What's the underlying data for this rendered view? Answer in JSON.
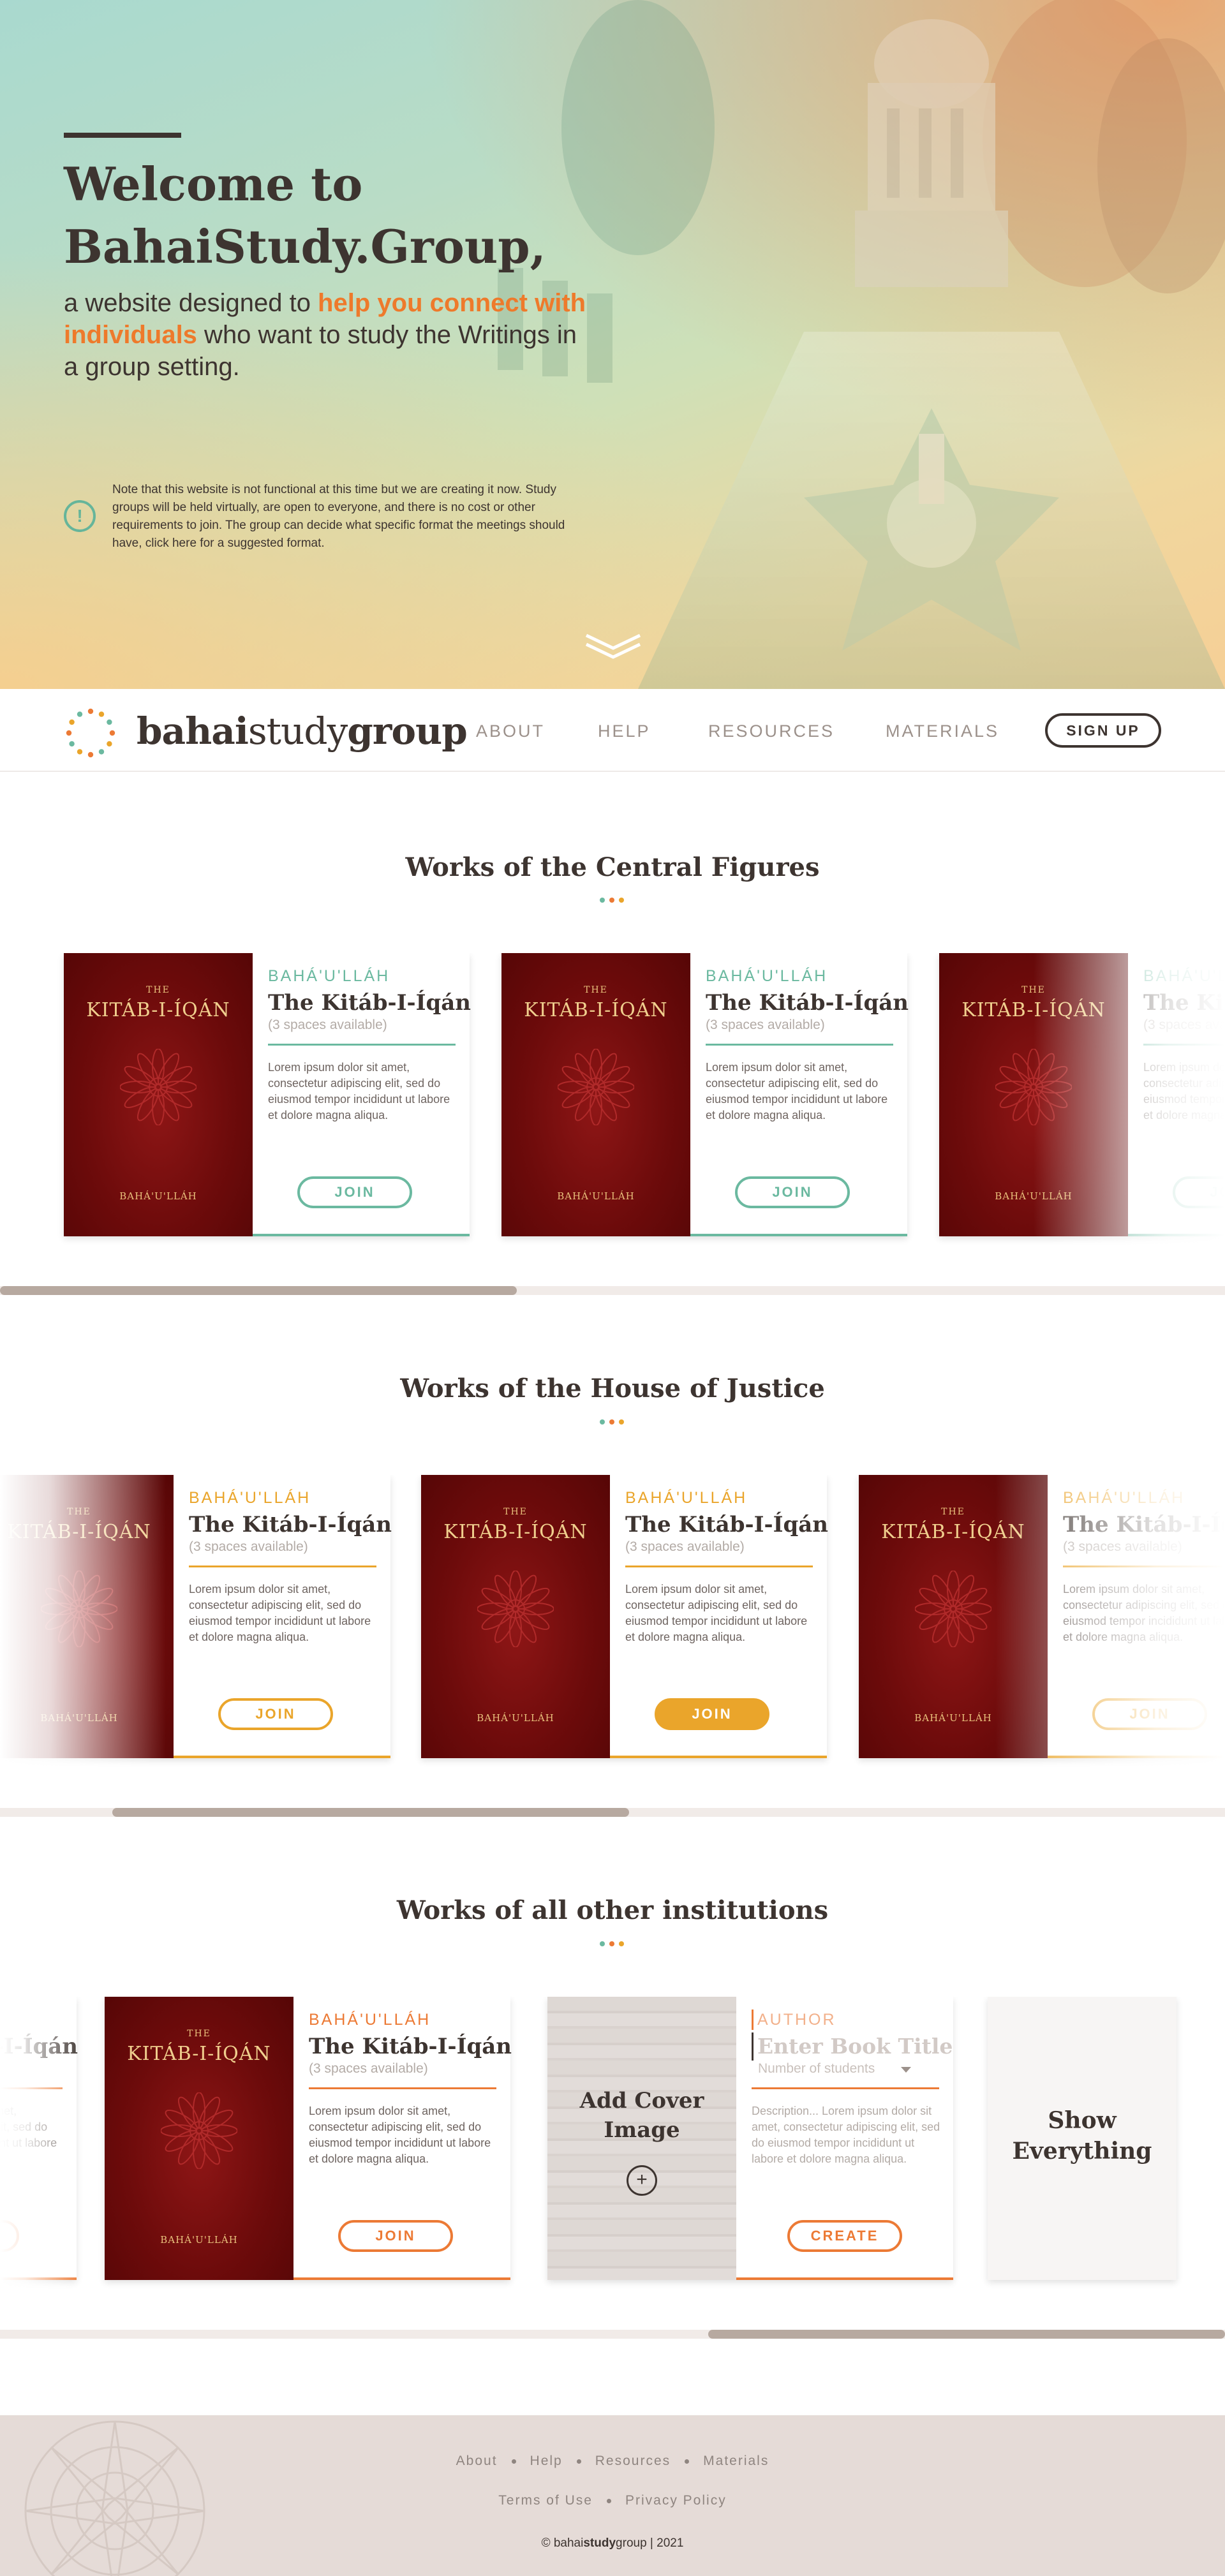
{
  "hero": {
    "title_line1": "Welcome to",
    "title_line2": "BahaiStudy.Group,",
    "sub_pre": "a website designed to ",
    "sub_highlight": "help you connect with individuals",
    "sub_post": " who want to study the Writings in a group setting.",
    "note_icon": "!",
    "note": "Note that this website is not functional at this time but we are creating it now. Study groups will be held virtually, are open to everyone, and there is no cost or other requirements to join. The group can decide what specific format the meetings should have, click here for a suggested format."
  },
  "nav": {
    "logo_bold1": "bahai",
    "logo_light": "study",
    "logo_bold2": "group",
    "links": [
      "ABOUT",
      "HELP",
      "RESOURCES",
      "MATERIALS"
    ],
    "signup": "SIGN UP"
  },
  "book": {
    "cover_the": "THE",
    "cover_title": "KITÁB-I-ÍQÁN",
    "cover_author": "BAHÁ'U'LLÁH",
    "author": "BAHÁ'U'LLÁH",
    "title": "The Kitáb-I-Íqán",
    "spaces": "(3 spaces available)",
    "desc": "Lorem ipsum dolor sit amet, consectetur adipiscing elit, sed do eiusmod tempor incididunt ut labore et dolore magna aliqua.",
    "join": "JOIN"
  },
  "sections": [
    {
      "title": "Works of the Central Figures",
      "accent": "#6bb9a0"
    },
    {
      "title": "Works of the House of Justice",
      "accent": "#eaa52b"
    },
    {
      "title": "Works of all other institutions",
      "accent": "#ec7a35"
    }
  ],
  "dot_colors": [
    "#6bb9a0",
    "#ec7a35",
    "#eaa52b"
  ],
  "new_book": {
    "add_cover": "Add Cover Image",
    "add_icon": "+",
    "author_placeholder": "AUTHOR",
    "title_placeholder": "Enter Book Title",
    "students_placeholder": "Number of students",
    "desc_placeholder": "Description... Lorem ipsum dolor sit amet, consectetur adipiscing elit, sed do eiusmod tempor incididunt ut labore et dolore magna aliqua.",
    "create": "CREATE"
  },
  "show_all": "Show Everything",
  "scrollbars": [
    0.42,
    0.42,
    0.42
  ],
  "footer": {
    "links1": [
      "About",
      "Help",
      "Resources",
      "Materials"
    ],
    "links2": [
      "Terms of Use",
      "Privacy Policy"
    ],
    "copy_pre": "© bahai",
    "copy_bold": "study",
    "copy_post": "group | 2021"
  }
}
